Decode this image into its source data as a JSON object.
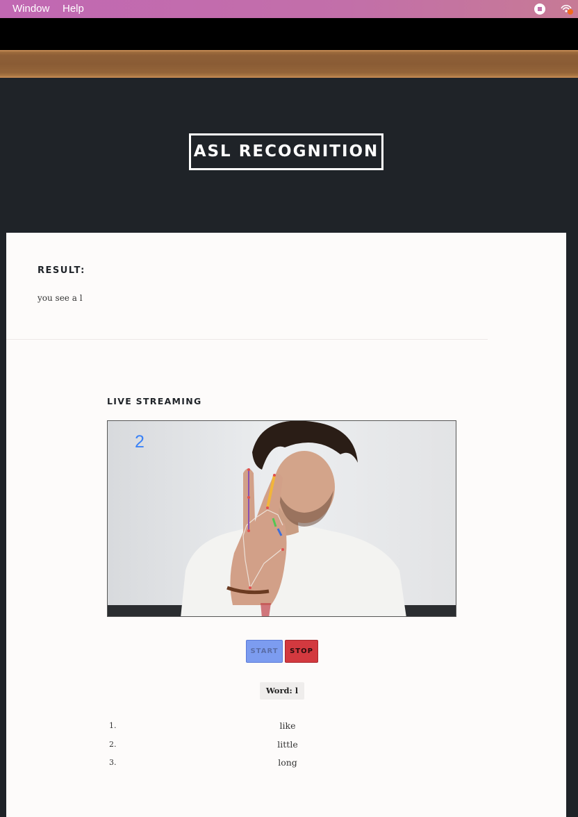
{
  "menubar": {
    "items": [
      {
        "label": "Window"
      },
      {
        "label": "Help"
      }
    ],
    "tray": [
      "stop-record-icon",
      "cast-icon"
    ]
  },
  "header": {
    "title": "ASL RECOGNITION"
  },
  "result": {
    "heading": "RESULT:",
    "text": "you see a l"
  },
  "live": {
    "heading": "LIVE STREAMING",
    "overlay_counter": "2"
  },
  "controls": {
    "start_label": "START",
    "stop_label": "STOP",
    "start_color": "#7c9cf0",
    "stop_color": "#d3393f"
  },
  "word": {
    "label": "Word: l"
  },
  "suggestions": [
    {
      "num": "1.",
      "word": "like"
    },
    {
      "num": "2.",
      "word": "little"
    },
    {
      "num": "3.",
      "word": "long"
    }
  ],
  "colors": {
    "menubar": "#c168b3",
    "page_bg": "#1f2328",
    "content_bg": "#fdfbfa",
    "counter": "#3b82f6"
  }
}
